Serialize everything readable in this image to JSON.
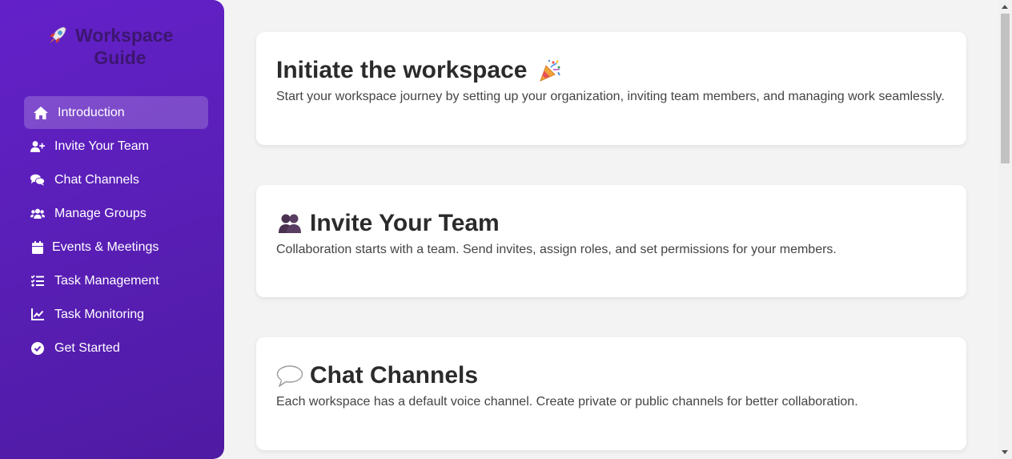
{
  "sidebar": {
    "brand": {
      "icon": "rocket-icon",
      "title": "Workspace Guide"
    },
    "items": [
      {
        "label": "Introduction",
        "icon": "home-icon",
        "active": true
      },
      {
        "label": "Invite Your Team",
        "icon": "user-plus-icon"
      },
      {
        "label": "Chat Channels",
        "icon": "comments-icon"
      },
      {
        "label": "Manage Groups",
        "icon": "users-icon"
      },
      {
        "label": "Events & Meetings",
        "icon": "calendar-icon"
      },
      {
        "label": "Task Management",
        "icon": "list-check-icon"
      },
      {
        "label": "Task Monitoring",
        "icon": "chart-line-icon"
      },
      {
        "label": "Get Started",
        "icon": "check-circle-icon"
      }
    ]
  },
  "main": {
    "cards": [
      {
        "title": "Initiate the workspace",
        "emoji": "party-popper-icon",
        "text": "Start your workspace journey by setting up your organization, inviting team members, and managing work seamlessly."
      },
      {
        "title": "Invite Your Team",
        "emoji": "busts-icon",
        "text": "Collaboration starts with a team. Send invites, assign roles, and set permissions for your members."
      },
      {
        "title": "Chat Channels",
        "emoji": "speech-balloon-icon",
        "text": "Each workspace has a default voice channel. Create private or public channels for better collaboration."
      }
    ]
  },
  "colors": {
    "sidebar_top": "#6320c9",
    "sidebar_bottom": "#4f1aa3",
    "brand_text": "#3d1670",
    "page_bg": "#f3f3f4"
  }
}
